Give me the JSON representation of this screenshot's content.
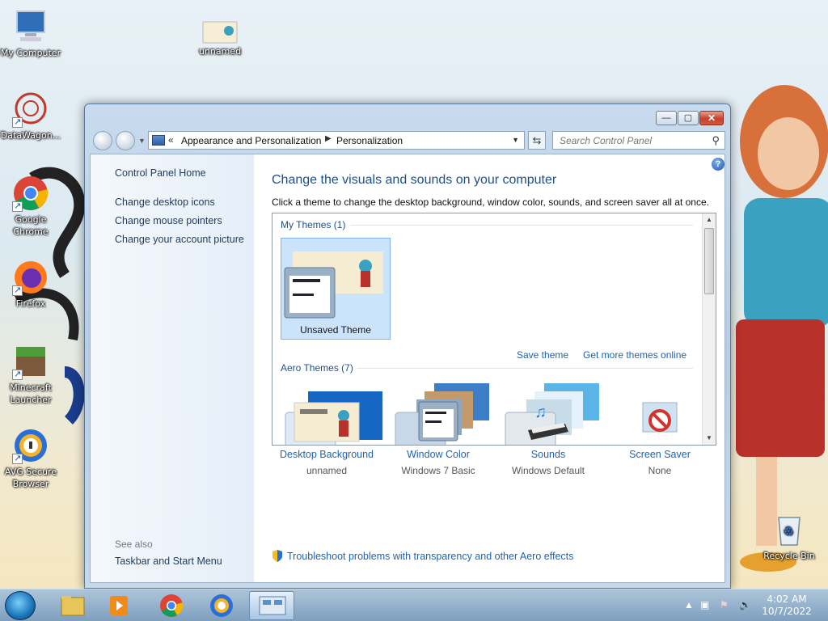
{
  "desktop": {
    "icons": [
      {
        "label": "My Computer",
        "icon": "computer-icon"
      },
      {
        "label": "unnamed",
        "icon": "image-file-icon"
      },
      {
        "label": "DataWagon...",
        "icon": "datawagon-icon"
      },
      {
        "label": "Google Chrome",
        "icon": "chrome-icon"
      },
      {
        "label": "Firefox",
        "icon": "firefox-icon"
      },
      {
        "label": "Minecraft Launcher",
        "icon": "minecraft-icon"
      },
      {
        "label": "AVG Secure Browser",
        "icon": "avg-browser-icon"
      },
      {
        "label": "Recycle Bin",
        "icon": "recycle-bin-icon"
      }
    ]
  },
  "window": {
    "controls": {
      "minimize": "—",
      "maximize": "▢",
      "close": "✕"
    },
    "address": {
      "chevron": "«",
      "crumbs": [
        "Appearance and Personalization",
        "Personalization"
      ],
      "separator": "▶"
    },
    "search_placeholder": "Search Control Panel",
    "left_pane": {
      "home": "Control Panel Home",
      "links": [
        "Change desktop icons",
        "Change mouse pointers",
        "Change your account picture"
      ],
      "see_also_label": "See also",
      "see_also_links": [
        "Taskbar and Start Menu"
      ]
    },
    "main": {
      "title": "Change the visuals and sounds on your computer",
      "subtitle": "Click a theme to change the desktop background, window color, sounds, and screen saver all at once.",
      "my_themes_label": "My Themes (1)",
      "selected_theme": "Unsaved Theme",
      "save_theme": "Save theme",
      "more_themes": "Get more themes online",
      "aero_themes_label": "Aero Themes (7)",
      "bottom": [
        {
          "label": "Desktop Background",
          "value": "unnamed",
          "icon": "desktop-background-icon"
        },
        {
          "label": "Window Color",
          "value": "Windows 7 Basic",
          "icon": "window-color-icon"
        },
        {
          "label": "Sounds",
          "value": "Windows Default",
          "icon": "sounds-icon"
        },
        {
          "label": "Screen Saver",
          "value": "None",
          "icon": "screen-saver-icon"
        }
      ],
      "troubleshoot": "Troubleshoot problems with transparency and other Aero effects"
    }
  },
  "taskbar": {
    "time": "4:02 AM",
    "date": "10/7/2022",
    "apps": [
      "explorer",
      "media-player",
      "chrome",
      "avg-browser",
      "control-panel"
    ]
  }
}
